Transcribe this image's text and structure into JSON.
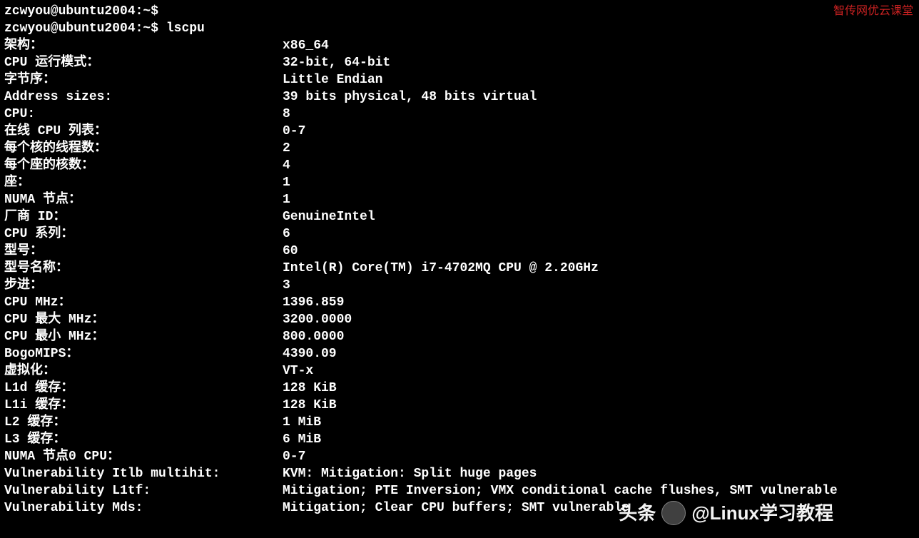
{
  "prompt1": "zcwyou@ubuntu2004:~$",
  "prompt2": "zcwyou@ubuntu2004:~$ ",
  "command": "lscpu",
  "rows": [
    {
      "label": "架构：",
      "value": "x86_64"
    },
    {
      "label": "CPU 运行模式：",
      "value": "32-bit, 64-bit"
    },
    {
      "label": "字节序：",
      "value": "Little Endian"
    },
    {
      "label": "Address sizes:",
      "value": "39 bits physical, 48 bits virtual"
    },
    {
      "label": "CPU:",
      "value": "8"
    },
    {
      "label": "在线 CPU 列表：",
      "value": "0-7"
    },
    {
      "label": "每个核的线程数：",
      "value": "2"
    },
    {
      "label": "每个座的核数：",
      "value": "4"
    },
    {
      "label": "座：",
      "value": "1"
    },
    {
      "label": "NUMA 节点：",
      "value": "1"
    },
    {
      "label": "厂商 ID：",
      "value": "GenuineIntel"
    },
    {
      "label": "CPU 系列：",
      "value": "6"
    },
    {
      "label": "型号：",
      "value": "60"
    },
    {
      "label": "型号名称：",
      "value": "Intel(R) Core(TM) i7-4702MQ CPU @ 2.20GHz"
    },
    {
      "label": "步进：",
      "value": "3"
    },
    {
      "label": "CPU MHz：",
      "value": "1396.859"
    },
    {
      "label": "CPU 最大 MHz：",
      "value": "3200.0000"
    },
    {
      "label": "CPU 最小 MHz：",
      "value": "800.0000"
    },
    {
      "label": "BogoMIPS：",
      "value": "4390.09"
    },
    {
      "label": "虚拟化：",
      "value": "VT-x"
    },
    {
      "label": "L1d 缓存：",
      "value": "128 KiB"
    },
    {
      "label": "L1i 缓存：",
      "value": "128 KiB"
    },
    {
      "label": "L2 缓存：",
      "value": "1 MiB"
    },
    {
      "label": "L3 缓存：",
      "value": "6 MiB"
    },
    {
      "label": "NUMA 节点0 CPU：",
      "value": "0-7"
    },
    {
      "label": "Vulnerability Itlb multihit:",
      "value": "KVM: Mitigation: Split huge pages"
    },
    {
      "label": "Vulnerability L1tf:",
      "value": "Mitigation; PTE Inversion; VMX conditional cache flushes, SMT vulnerable"
    },
    {
      "label": "Vulnerability Mds:",
      "value": "Mitigation; Clear CPU buffers; SMT vulnerable"
    }
  ],
  "watermark_top": "智传网优云课堂",
  "watermark_bottom_prefix": "头条",
  "watermark_bottom_handle": "@Linux学习教程"
}
